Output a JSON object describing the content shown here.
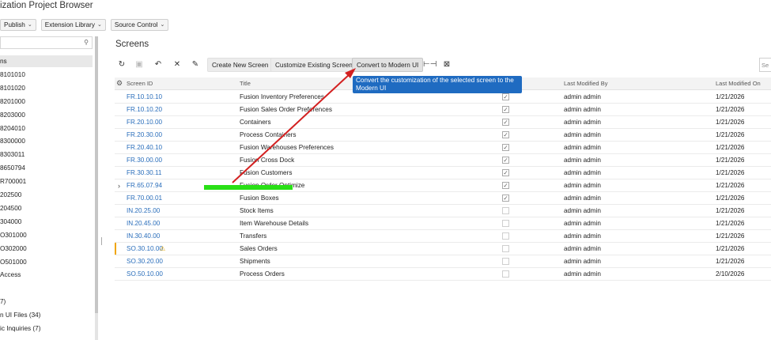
{
  "app": {
    "title": "ization Project Browser"
  },
  "topbar": [
    {
      "name": "publish-menu",
      "label": "Publish"
    },
    {
      "name": "extension-library-menu",
      "label": "Extension Library"
    },
    {
      "name": "source-control-menu",
      "label": "Source Control"
    }
  ],
  "sidebar": {
    "search_placeholder": "",
    "items": [
      "ns",
      "8101010",
      "8101020",
      "8201000",
      "8203000",
      "8204010",
      "8300000",
      "8303011",
      "8650794",
      "R700001",
      "202500",
      "204500",
      "304000",
      "O301000",
      "O302000",
      "O501000",
      "Access",
      "",
      "7)",
      "n UI Files (34)",
      "ic Inquiries (7)"
    ]
  },
  "main": {
    "title": "Screens",
    "toolbar": {
      "create_new_screen": "Create New Screen",
      "customize_existing_screen": "Customize Existing Screen",
      "convert_to_modern_ui": "Convert to Modern UI",
      "search_placeholder": "Se"
    },
    "tooltip": "Convert the customization of the selected screen to the Modern UI",
    "columns": {
      "screen_id": "Screen ID",
      "title": "Title",
      "last_modified_by": "Last Modified By",
      "last_modified_on": "Last Modified On"
    },
    "rows": [
      {
        "screen_id": "FR.10.10.10",
        "title": "Fusion Inventory Preferences",
        "checked": true,
        "modified_by": "admin admin",
        "modified_on": "1/21/2026"
      },
      {
        "screen_id": "FR.10.10.20",
        "title": "Fusion Sales Order Preferences",
        "checked": true,
        "modified_by": "admin admin",
        "modified_on": "1/21/2026"
      },
      {
        "screen_id": "FR.20.10.00",
        "title": "Containers",
        "checked": true,
        "modified_by": "admin admin",
        "modified_on": "1/21/2026"
      },
      {
        "screen_id": "FR.20.30.00",
        "title": "Process Containers",
        "checked": true,
        "modified_by": "admin admin",
        "modified_on": "1/21/2026"
      },
      {
        "screen_id": "FR.20.40.10",
        "title": "Fusion Warehouses Preferences",
        "checked": true,
        "modified_by": "admin admin",
        "modified_on": "1/21/2026"
      },
      {
        "screen_id": "FR.30.00.00",
        "title": "Fusion Cross Dock",
        "checked": true,
        "modified_by": "admin admin",
        "modified_on": "1/21/2026"
      },
      {
        "screen_id": "FR.30.30.11",
        "title": "Fusion Customers",
        "checked": true,
        "modified_by": "admin admin",
        "modified_on": "1/21/2026"
      },
      {
        "screen_id": "FR.65.07.94",
        "title": "Fusion Order Optimize",
        "checked": true,
        "modified_by": "admin admin",
        "modified_on": "1/21/2026"
      },
      {
        "screen_id": "FR.70.00.01",
        "title": "Fusion Boxes",
        "checked": true,
        "modified_by": "admin admin",
        "modified_on": "1/21/2026"
      },
      {
        "screen_id": "IN.20.25.00",
        "title": "Stock Items",
        "checked": false,
        "modified_by": "admin admin",
        "modified_on": "1/21/2026"
      },
      {
        "screen_id": "IN.20.45.00",
        "title": "Item Warehouse Details",
        "checked": false,
        "modified_by": "admin admin",
        "modified_on": "1/21/2026"
      },
      {
        "screen_id": "IN.30.40.00",
        "title": "Transfers",
        "checked": false,
        "modified_by": "admin admin",
        "modified_on": "1/21/2026"
      },
      {
        "screen_id": "SO.30.10.00",
        "title": "Sales Orders",
        "checked": false,
        "modified_by": "admin admin",
        "modified_on": "1/21/2026",
        "warning": true
      },
      {
        "screen_id": "SO.30.20.00",
        "title": "Shipments",
        "checked": false,
        "modified_by": "admin admin",
        "modified_on": "1/21/2026"
      },
      {
        "screen_id": "SO.50.10.00",
        "title": "Process Orders",
        "checked": false,
        "modified_by": "admin admin",
        "modified_on": "2/10/2026"
      }
    ]
  }
}
